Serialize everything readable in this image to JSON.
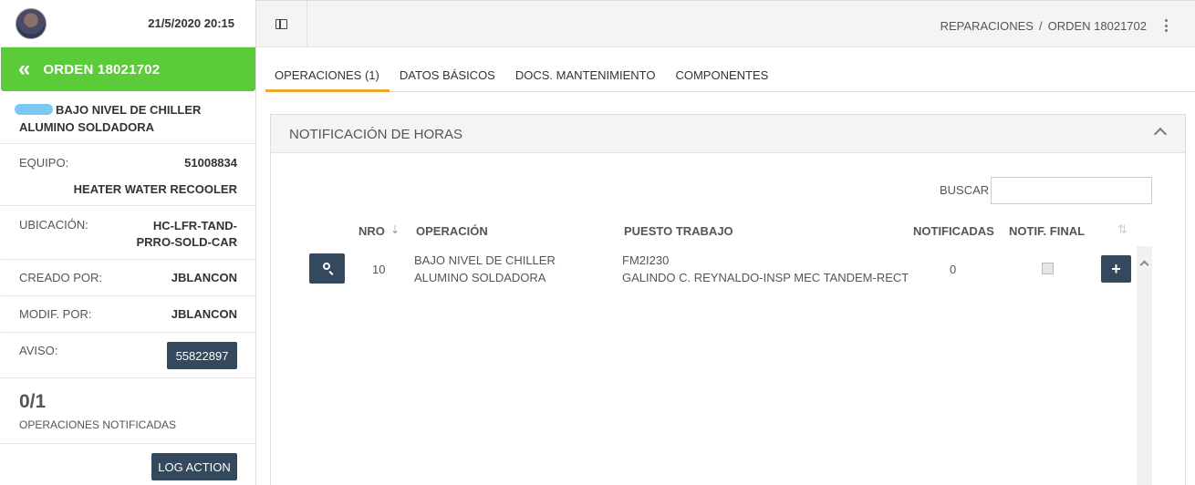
{
  "header": {
    "datetime": "21/5/2020 20:15",
    "breadcrumb": [
      "REPARACIONES",
      "ORDEN 18021702"
    ],
    "breadcrumb_sep": "/"
  },
  "sidebar": {
    "order_title": "ORDEN 18021702",
    "back_icon": "«",
    "description": "BAJO NIVEL DE CHILLER ALUMINO SOLDADORA",
    "equipo_label": "EQUIPO:",
    "equipo_code": "51008834",
    "equipo_name": "HEATER WATER RECOOLER",
    "ubicacion_label": "UBICACIÓN:",
    "ubicacion_value_line1": "HC-LFR-TAND-",
    "ubicacion_value_line2": "PRRO-SOLD-CAR",
    "creado_label": "CREADO POR:",
    "creado_value": "JBLANCON",
    "modif_label": "MODIF. POR:",
    "modif_value": "JBLANCON",
    "aviso_label": "AVISO:",
    "aviso_value": "55822897",
    "ops_count": "0/1",
    "ops_label": "OPERACIONES NOTIFICADAS",
    "log_action": "LOG ACTION",
    "accent_color": "#5ccb3a"
  },
  "tabs": [
    {
      "label": "OPERACIONES (1)",
      "active": true
    },
    {
      "label": "DATOS BÁSICOS",
      "active": false
    },
    {
      "label": "DOCS. MANTENIMIENTO",
      "active": false
    },
    {
      "label": "COMPONENTES",
      "active": false
    }
  ],
  "panel": {
    "title": "NOTIFICACIÓN DE HORAS",
    "search_label": "BUSCAR",
    "search_value": "",
    "columns": {
      "nro": "NRO",
      "operacion": "OPERACIÓN",
      "puesto": "PUESTO TRABAJO",
      "notificadas": "NOTIFICADAS",
      "notif_final": "NOTIF. FINAL"
    },
    "rows": [
      {
        "nro": "10",
        "operacion": "BAJO NIVEL DE CHILLER ALUMINO SOLDADORA",
        "puesto_code": "FM2I230",
        "puesto_name": "GALINDO C. REYNALDO-INSP MEC TANDEM-RECT",
        "notificadas": "0",
        "notif_final": false,
        "add_label": "+"
      }
    ]
  }
}
